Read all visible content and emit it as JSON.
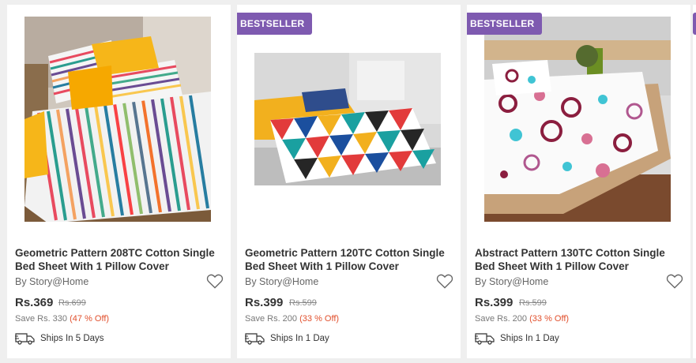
{
  "products": [
    {
      "title_line1": "Geometric Pattern 208TC Cotton Single",
      "title_line2": "Bed Sheet With 1 Pillow Cover",
      "brand": "By Story@Home",
      "price": "Rs.369",
      "mrp": "Rs.699",
      "save": "Save Rs. 330",
      "discount": "(47 % Off)",
      "shipping": "Ships In 5 Days",
      "badge": ""
    },
    {
      "title_line1": "Geometric Pattern 120TC Cotton Single",
      "title_line2": "Bed Sheet With 1 Pillow Cover",
      "brand": "By Story@Home",
      "price": "Rs.399",
      "mrp": "Rs.599",
      "save": "Save Rs. 200",
      "discount": "(33 % Off)",
      "shipping": "Ships In 1 Day",
      "badge": "BESTSELLER"
    },
    {
      "title_line1": "Abstract Pattern 130TC Cotton Single",
      "title_line2": "Bed Sheet With 1 Pillow Cover",
      "brand": "By Story@Home",
      "price": "Rs.399",
      "mrp": "Rs.599",
      "save": "Save Rs. 200",
      "discount": "(33 % Off)",
      "shipping": "Ships In 1 Day",
      "badge": "BESTSELLER"
    }
  ],
  "colors": {
    "badge": "#7e5ab0",
    "discount": "#e1502d",
    "background": "#efefef"
  },
  "icons": [
    "heart-icon",
    "truck-icon"
  ]
}
